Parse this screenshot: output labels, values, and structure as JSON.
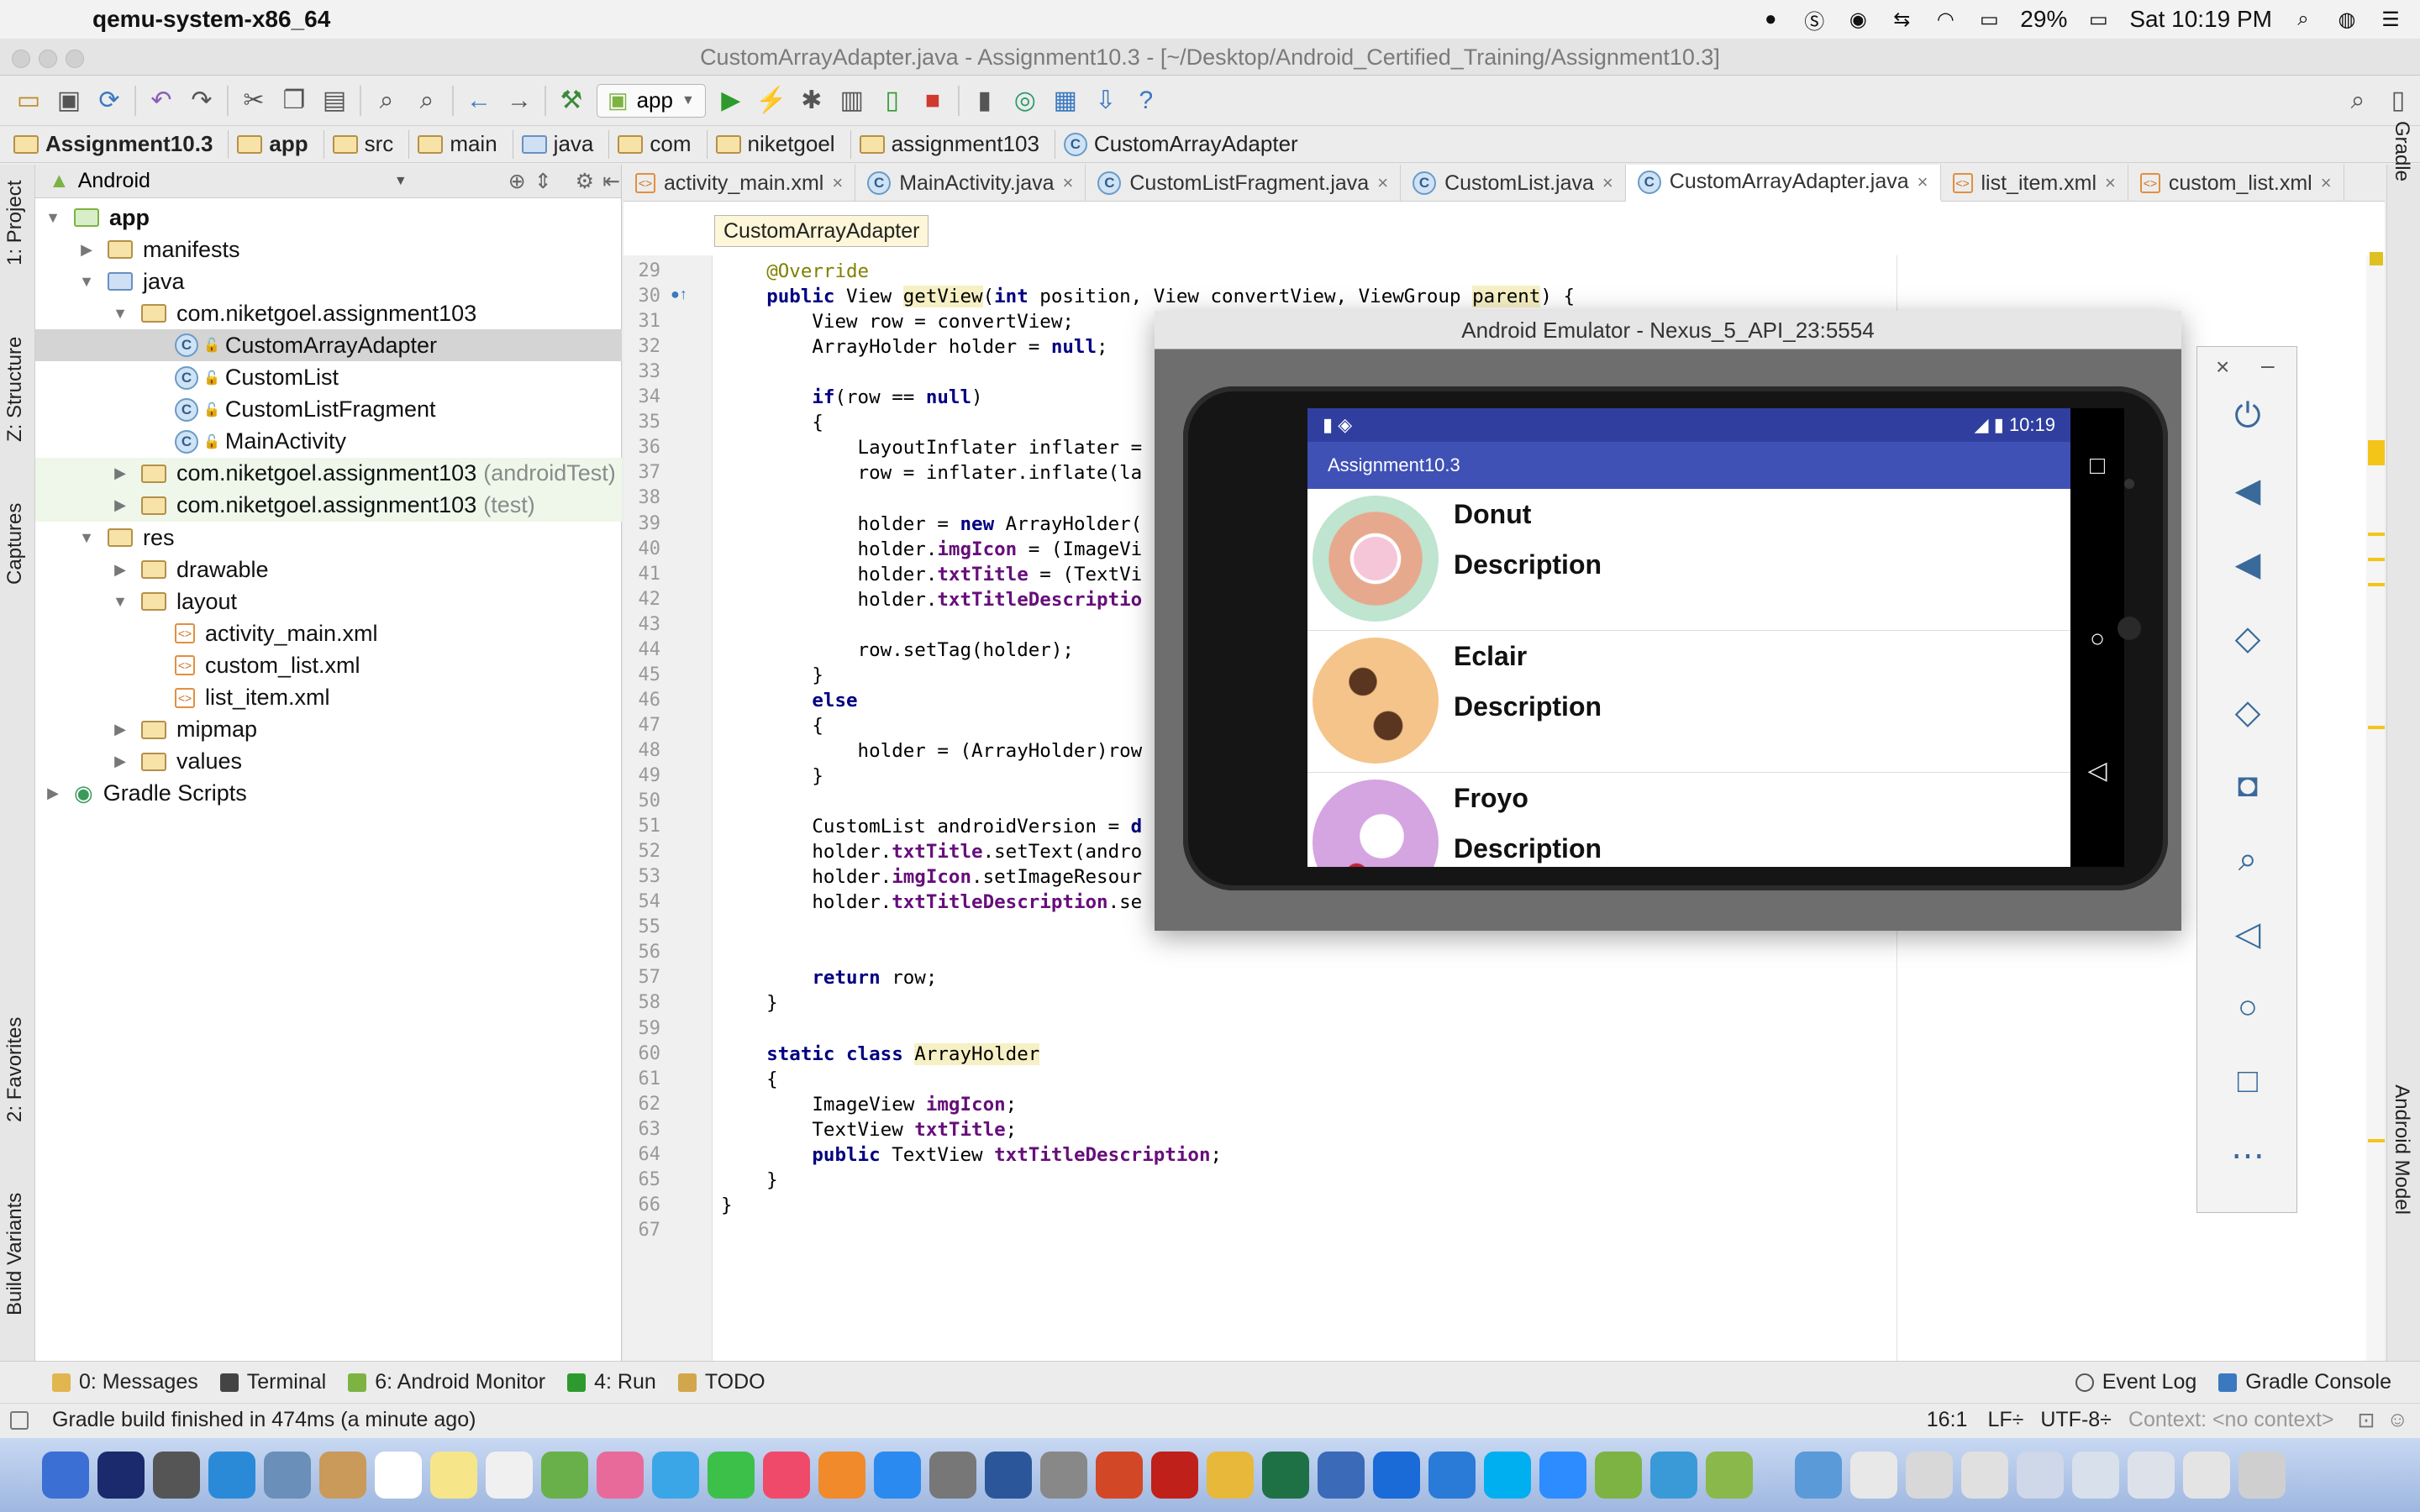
{
  "menubar": {
    "app_name": "qemu-system-x86_64",
    "battery": "29%",
    "clock": "Sat 10:19 PM"
  },
  "window": {
    "title": "CustomArrayAdapter.java - Assignment10.3 - [~/Desktop/Android_Certified_Training/Assignment10.3]"
  },
  "toolbar": {
    "run_config": "app"
  },
  "navbar": {
    "crumbs": [
      "Assignment10.3",
      "app",
      "src",
      "main",
      "java",
      "com",
      "niketgoel",
      "assignment103",
      "CustomArrayAdapter"
    ]
  },
  "left_tabs": [
    "1: Project",
    "Z: Structure",
    "Captures",
    "2: Favorites",
    "Build Variants"
  ],
  "right_tabs": [
    "Gradle",
    "Android Model"
  ],
  "project": {
    "view_selector": "Android",
    "tree": [
      {
        "label": "app",
        "arrow": "▼"
      },
      {
        "label": "manifests",
        "arrow": "▶"
      },
      {
        "label": "java",
        "arrow": "▼"
      },
      {
        "label": "com.niketgoel.assignment103",
        "arrow": "▼"
      },
      {
        "label": "CustomArrayAdapter",
        "arrow": ""
      },
      {
        "label": "CustomList",
        "arrow": ""
      },
      {
        "label": "CustomListFragment",
        "arrow": ""
      },
      {
        "label": "MainActivity",
        "arrow": ""
      },
      {
        "label": "com.niketgoel.assignment103",
        "suffix": "(androidTest)",
        "arrow": "▶"
      },
      {
        "label": "com.niketgoel.assignment103",
        "suffix": "(test)",
        "arrow": "▶"
      },
      {
        "label": "res",
        "arrow": "▼"
      },
      {
        "label": "drawable",
        "arrow": "▶"
      },
      {
        "label": "layout",
        "arrow": "▼"
      },
      {
        "label": "activity_main.xml",
        "arrow": ""
      },
      {
        "label": "custom_list.xml",
        "arrow": ""
      },
      {
        "label": "list_item.xml",
        "arrow": ""
      },
      {
        "label": "mipmap",
        "arrow": "▶"
      },
      {
        "label": "values",
        "arrow": "▶"
      },
      {
        "label": "Gradle Scripts",
        "arrow": "▶"
      }
    ]
  },
  "editor": {
    "tabs": [
      {
        "label": "activity_main.xml"
      },
      {
        "label": "MainActivity.java"
      },
      {
        "label": "CustomListFragment.java"
      },
      {
        "label": "CustomList.java"
      },
      {
        "label": "CustomArrayAdapter.java"
      },
      {
        "label": "list_item.xml"
      },
      {
        "label": "custom_list.xml"
      }
    ],
    "breadcrumb": "CustomArrayAdapter",
    "line_numbers": [
      "29",
      "30",
      "31",
      "32",
      "33",
      "34",
      "35",
      "36",
      "37",
      "38",
      "39",
      "40",
      "41",
      "42",
      "43",
      "44",
      "45",
      "46",
      "47",
      "48",
      "49",
      "50",
      "51",
      "52",
      "53",
      "54",
      "55",
      "56",
      "57",
      "58",
      "59",
      "60",
      "61",
      "62",
      "63",
      "64",
      "65",
      "66",
      "67"
    ]
  },
  "emulator": {
    "title": "Android Emulator - Nexus_5_API_23:5554",
    "status_time": "10:19",
    "app_title": "Assignment10.3",
    "items": [
      {
        "title": "Donut",
        "desc": "Description"
      },
      {
        "title": "Eclair",
        "desc": "Description"
      },
      {
        "title": "Froyo",
        "desc": "Description"
      }
    ]
  },
  "bottom_tools": {
    "messages": "0: Messages",
    "terminal": "Terminal",
    "monitor": "6: Android Monitor",
    "run": "4: Run",
    "todo": "TODO",
    "event_log": "Event Log",
    "gradle_console": "Gradle Console"
  },
  "status": {
    "message": "Gradle build finished in 474ms (a minute ago)",
    "position": "16:1",
    "line_sep": "LF÷",
    "encoding": "UTF-8÷",
    "context": "Context: <no context>"
  },
  "colors": {
    "android_primary": "#3f51b5",
    "android_primary_dark": "#303f9f",
    "keyword": "#000080",
    "field": "#660e7a",
    "annotation": "#808000"
  }
}
